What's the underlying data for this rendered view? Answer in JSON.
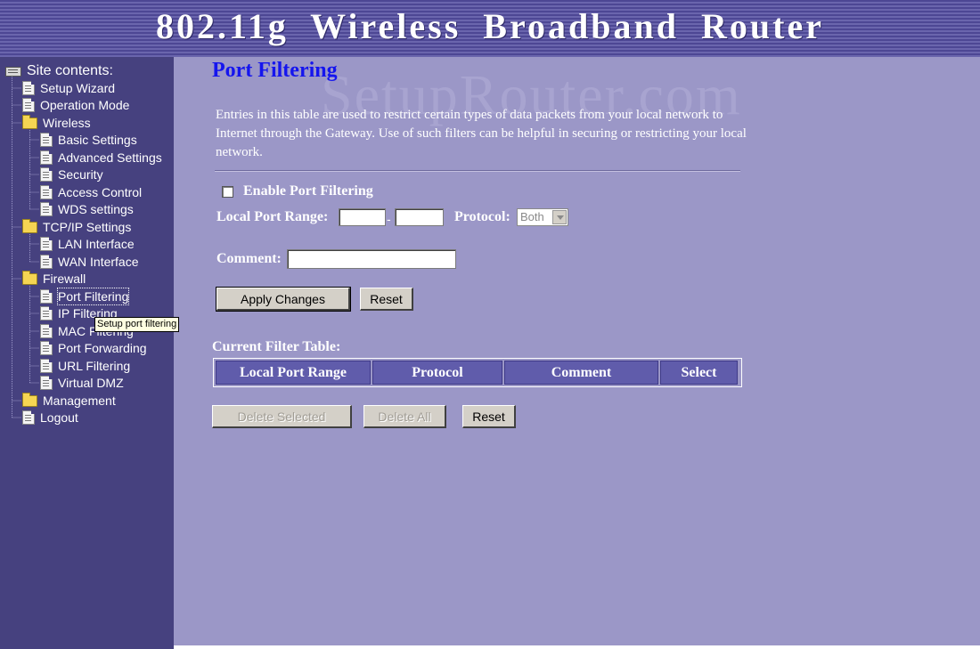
{
  "header": {
    "title": "802.11g  Wireless  Broadband  Router"
  },
  "sidebar": {
    "root_label": "Site contents:",
    "items": [
      {
        "label": "Setup Wizard",
        "icon": "document-icon"
      },
      {
        "label": "Operation Mode",
        "icon": "document-icon"
      },
      {
        "label": "Wireless",
        "icon": "folder-icon"
      },
      {
        "label": "Basic Settings",
        "icon": "document-icon"
      },
      {
        "label": "Advanced Settings",
        "icon": "document-icon"
      },
      {
        "label": "Security",
        "icon": "document-icon"
      },
      {
        "label": "Access Control",
        "icon": "document-icon"
      },
      {
        "label": "WDS settings",
        "icon": "document-icon"
      },
      {
        "label": "TCP/IP Settings",
        "icon": "folder-icon"
      },
      {
        "label": "LAN Interface",
        "icon": "document-icon"
      },
      {
        "label": "WAN Interface",
        "icon": "document-icon"
      },
      {
        "label": "Firewall",
        "icon": "folder-icon"
      },
      {
        "label": "Port Filtering",
        "icon": "document-icon"
      },
      {
        "label": "IP Filtering",
        "icon": "document-icon"
      },
      {
        "label": "MAC Filtering",
        "icon": "document-icon"
      },
      {
        "label": "Port Forwarding",
        "icon": "document-icon"
      },
      {
        "label": "URL Filtering",
        "icon": "document-icon"
      },
      {
        "label": "Virtual DMZ",
        "icon": "document-icon"
      },
      {
        "label": "Management",
        "icon": "folder-icon"
      },
      {
        "label": "Logout",
        "icon": "document-icon"
      }
    ],
    "tooltip": "Setup port filtering"
  },
  "main": {
    "watermark": "SetupRouter.com",
    "title": "Port Filtering",
    "description": "Entries in this table are used to restrict certain types of data packets from your local network to Internet through the Gateway. Use of such filters can be helpful in securing or restricting your local network.",
    "enable_label": "Enable Port Filtering",
    "enable_checked": false,
    "port_range_label": "Local Port Range:",
    "port_from": "",
    "port_to": "",
    "protocol_label": "Protocol:",
    "protocol_value": "Both",
    "comment_label": "Comment:",
    "comment_value": "",
    "apply_button": "Apply Changes",
    "reset_button": "Reset",
    "table_title": "Current Filter Table:",
    "table_headers": [
      "Local Port Range",
      "Protocol",
      "Comment",
      "Select"
    ],
    "delete_selected_button": "Delete Selected",
    "delete_all_button": "Delete All",
    "reset2_button": "Reset"
  },
  "colors": {
    "sidebar_bg": "#46417f",
    "main_bg": "#9b97c7",
    "title_blue": "#1515ee",
    "table_header_bg": "#605cab"
  }
}
